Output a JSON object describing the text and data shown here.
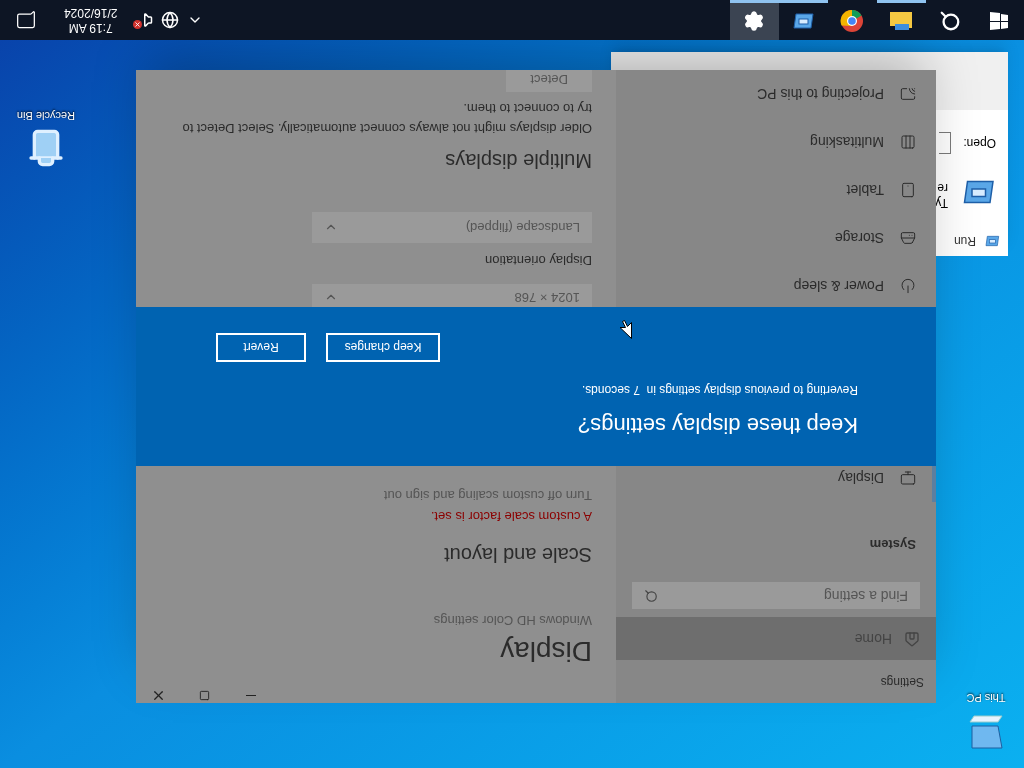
{
  "desktop_icons": [
    {
      "kind": "pc",
      "label": "This PC"
    },
    {
      "kind": "bin",
      "label": "Recycle Bin"
    }
  ],
  "run_dialog": {
    "title": "Run",
    "description_lines": [
      "Ty",
      "re"
    ],
    "open_label": "Open:"
  },
  "settings": {
    "title": "Settings",
    "home": {
      "label": "Home",
      "selected": true
    },
    "search": {
      "placeholder": "Find a setting"
    },
    "section": "System",
    "items": [
      {
        "label": "Display",
        "selected": true
      },
      {
        "label": "Power & sleep",
        "selected": false
      },
      {
        "label": "Storage",
        "selected": false
      },
      {
        "label": "Tablet",
        "selected": false
      },
      {
        "label": "Multitasking",
        "selected": false
      },
      {
        "label": "Projecting to this PC",
        "selected": false
      }
    ],
    "content": {
      "heading": "Display",
      "hd_link": "Windows HD Color settings",
      "scale_heading": "Scale and layout",
      "warning": "A custom scale factor is set.",
      "turn_off_link": "Turn off custom scaling and sign out",
      "resolution": "1024 × 768",
      "orientation_label": "Display orientation",
      "orientation": "Landscape (flipped)",
      "multi_heading": "Multiple displays",
      "multi_text": "Older displays might not always connect automatically. Select Detect to try to connect to them.",
      "detect": "Detect"
    }
  },
  "dialog": {
    "title": "Keep these display settings?",
    "message": "Reverting to previous display settings in  7 seconds.",
    "buttons": [
      "Keep changes",
      "Revert"
    ]
  },
  "taskbar": {
    "apps": [
      {
        "kind": "start",
        "running": false,
        "selected": false
      },
      {
        "kind": "search",
        "running": false,
        "selected": false
      },
      {
        "kind": "explorer",
        "running": true,
        "selected": false
      },
      {
        "kind": "chrome",
        "running": false,
        "selected": false
      },
      {
        "kind": "run",
        "running": true,
        "selected": false
      },
      {
        "kind": "settings",
        "running": true,
        "selected": true
      }
    ],
    "volume_muted": true,
    "time": "7:19 AM",
    "date": "2/16/2024"
  }
}
